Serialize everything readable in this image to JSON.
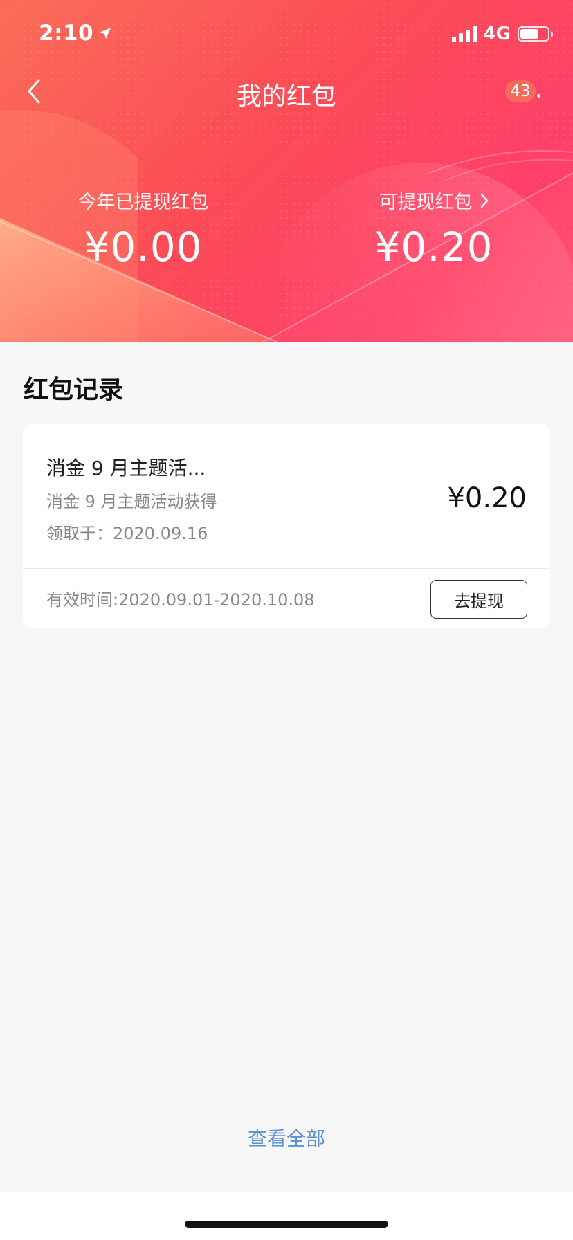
{
  "status_bar": {
    "time": "2:10",
    "network": "4G",
    "battery_level": 0.62
  },
  "navbar": {
    "title": "我的红包",
    "badge_count": "43"
  },
  "summary": {
    "withdrawn_label": "今年已提现红包",
    "withdrawn_amount": "¥0.00",
    "available_label": "可提现红包",
    "available_amount": "¥0.20"
  },
  "records": {
    "section_title": "红包记录",
    "items": [
      {
        "name": "消金 9 月主题活...",
        "description": "消金 9 月主题活动获得",
        "received_date": "领取于：2020.09.16",
        "amount": "¥0.20",
        "valid_period": "有效时间:2020.09.01-2020.10.08",
        "action_label": "去提现"
      }
    ]
  },
  "footer": {
    "view_all_label": "查看全部"
  },
  "colors": {
    "header_gradient_start": "#fa6d58",
    "header_gradient_end": "#ff3f6a",
    "link_blue": "#5b8fd0",
    "badge": "#f46b5c"
  },
  "icons": {
    "back": "chevron-left-icon",
    "more": "more-dots-icon",
    "location": "location-arrow-icon",
    "chevron": "chevron-right-icon"
  }
}
